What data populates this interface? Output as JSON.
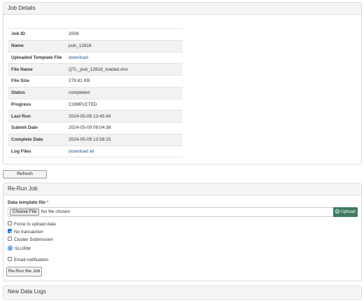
{
  "job_details": {
    "title": "Job Details",
    "rows": [
      {
        "label": "Job ID",
        "value": "2006"
      },
      {
        "label": "Name",
        "value": "pub_12818"
      },
      {
        "label": "Uploaded Template File",
        "value": "download"
      },
      {
        "label": "File Name",
        "value": "QTL_pub_12818_loaded.xlsx"
      },
      {
        "label": "File Size",
        "value": "279.81 KB"
      },
      {
        "label": "Status",
        "value": "completed"
      },
      {
        "label": "Progress",
        "value": "COMPLETED"
      },
      {
        "label": "Last Run",
        "value": "2024-05-09 13:45:49"
      },
      {
        "label": "Submit Date",
        "value": "2024-05-09 09:04:38"
      },
      {
        "label": "Complete Date",
        "value": "2024-05-09 13:58:15"
      },
      {
        "label": "Log Files",
        "value": "download all"
      }
    ]
  },
  "refresh_label": "Refresh",
  "rerun": {
    "title": "Re-Run Job",
    "file_label": "Data template file",
    "required_mark": "*",
    "choose_file_label": "Choose File",
    "no_file_text": "No file chosen",
    "upload_label": "Upload",
    "options": {
      "force_upload": {
        "label": "Force to upload data",
        "checked": false
      },
      "no_transaction": {
        "label": "No transaction",
        "checked": true
      },
      "cluster_submission": {
        "label": "Cluster Submission",
        "checked": false
      },
      "slurm": {
        "label": "SLURM",
        "checked": true
      },
      "email_notification": {
        "label": "Email notification",
        "checked": false
      }
    },
    "rerun_button_label": "Re-Run the Job"
  },
  "new_data_logs": {
    "title": "New Data Logs"
  },
  "colors": {
    "upload_button": "#3f7b60",
    "link": "#1f5a93",
    "checkbox_accent": "#1a73e8",
    "required": "#d9534f"
  }
}
